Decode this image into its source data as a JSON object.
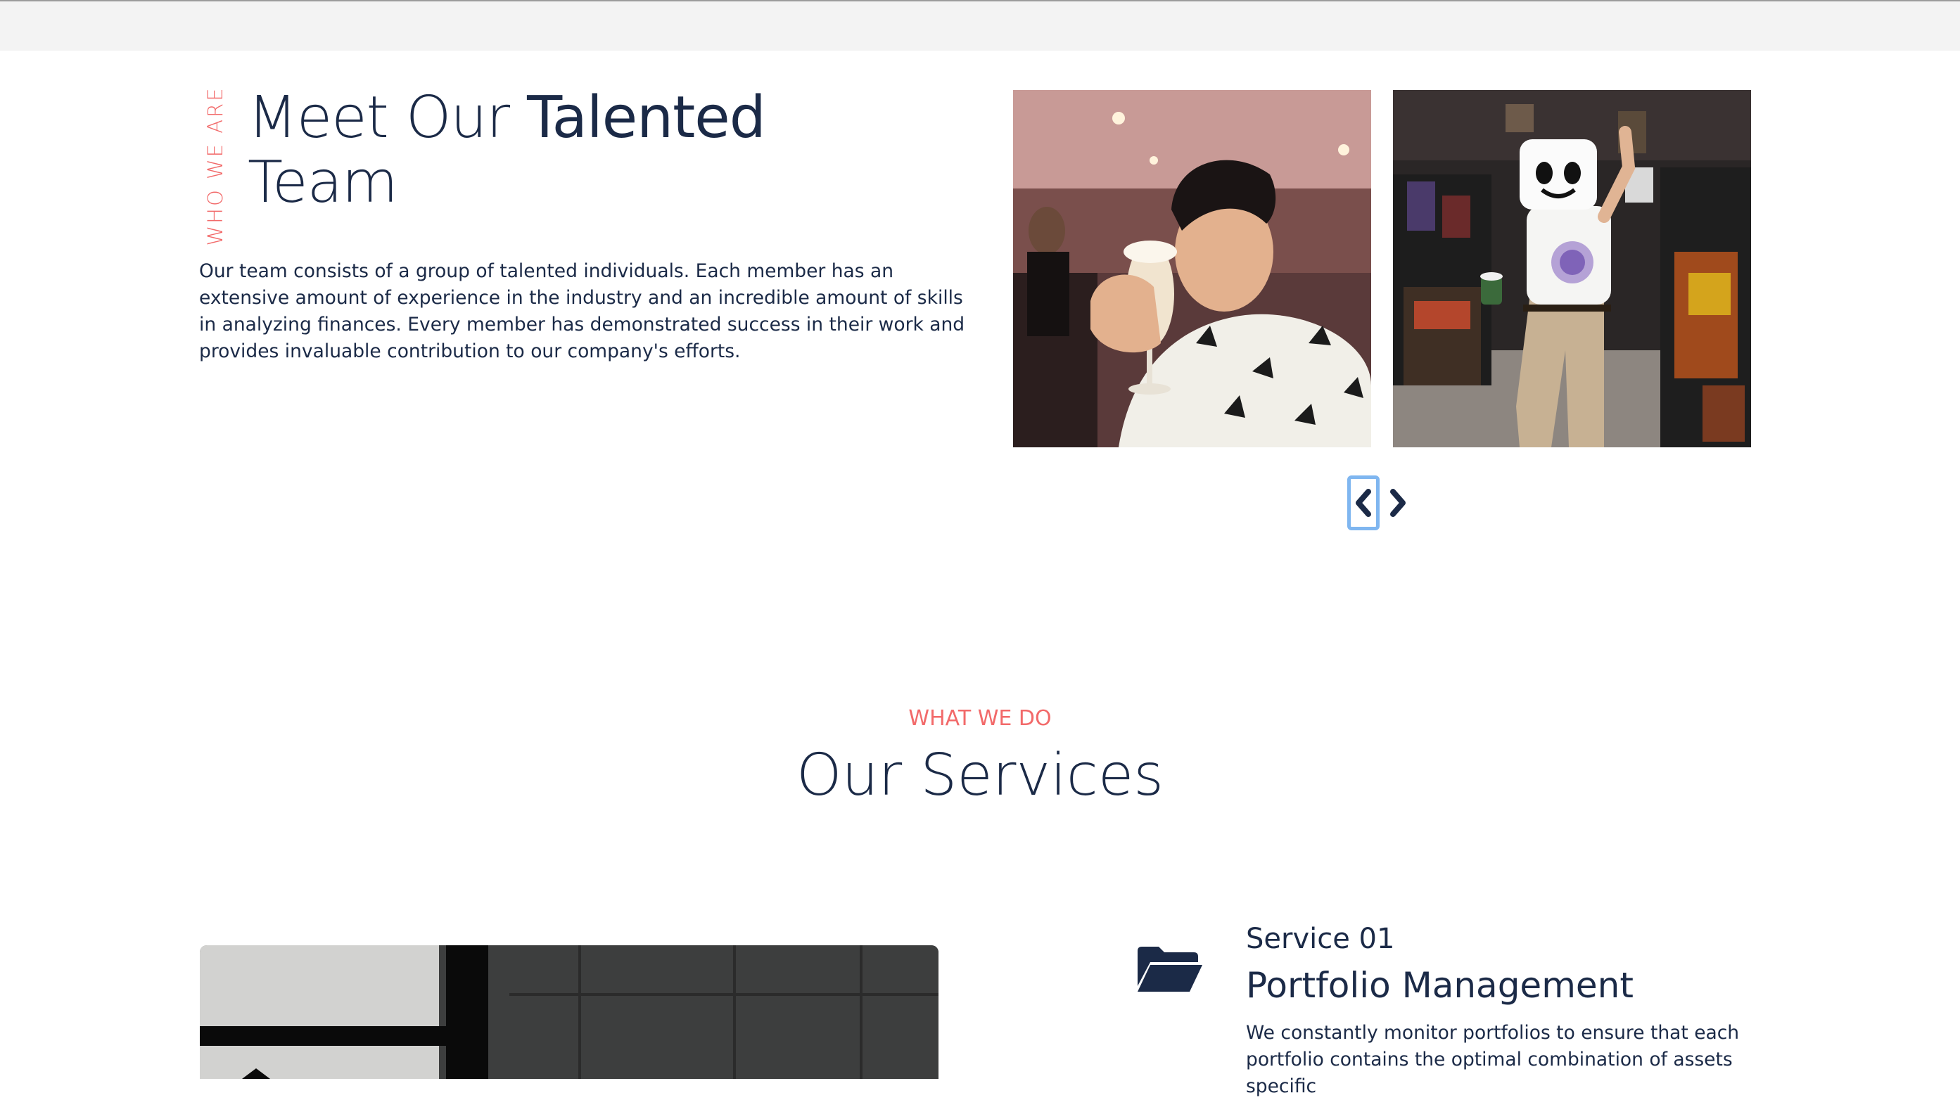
{
  "team": {
    "eyebrow": "WHO WE ARE",
    "title_light": "Meet Our ",
    "title_strong": "Talented",
    "title_line2": "Team",
    "description": "Our team consists of a group of talented individuals. Each member has an extensive amount of experience in the industry and an incredible amount of skills in analyzing finances. Every member has demonstrated success in their work and provides invaluable contribution to our company's efforts."
  },
  "carousel": {
    "prev_icon": "chevron-left-icon",
    "next_icon": "chevron-right-icon"
  },
  "services": {
    "eyebrow": "WHAT WE DO",
    "title": "Our Services",
    "items": [
      {
        "number": "Service 01",
        "title": "Portfolio Management",
        "description": "We constantly monitor portfolios to ensure that each portfolio contains the optimal combination of assets specific",
        "icon": "folder-open-icon"
      }
    ]
  },
  "colors": {
    "accent": "#f26a6a",
    "navy": "#1b2a47",
    "focus_ring": "#7fb6f0",
    "topbar": "#f3f3f3"
  }
}
